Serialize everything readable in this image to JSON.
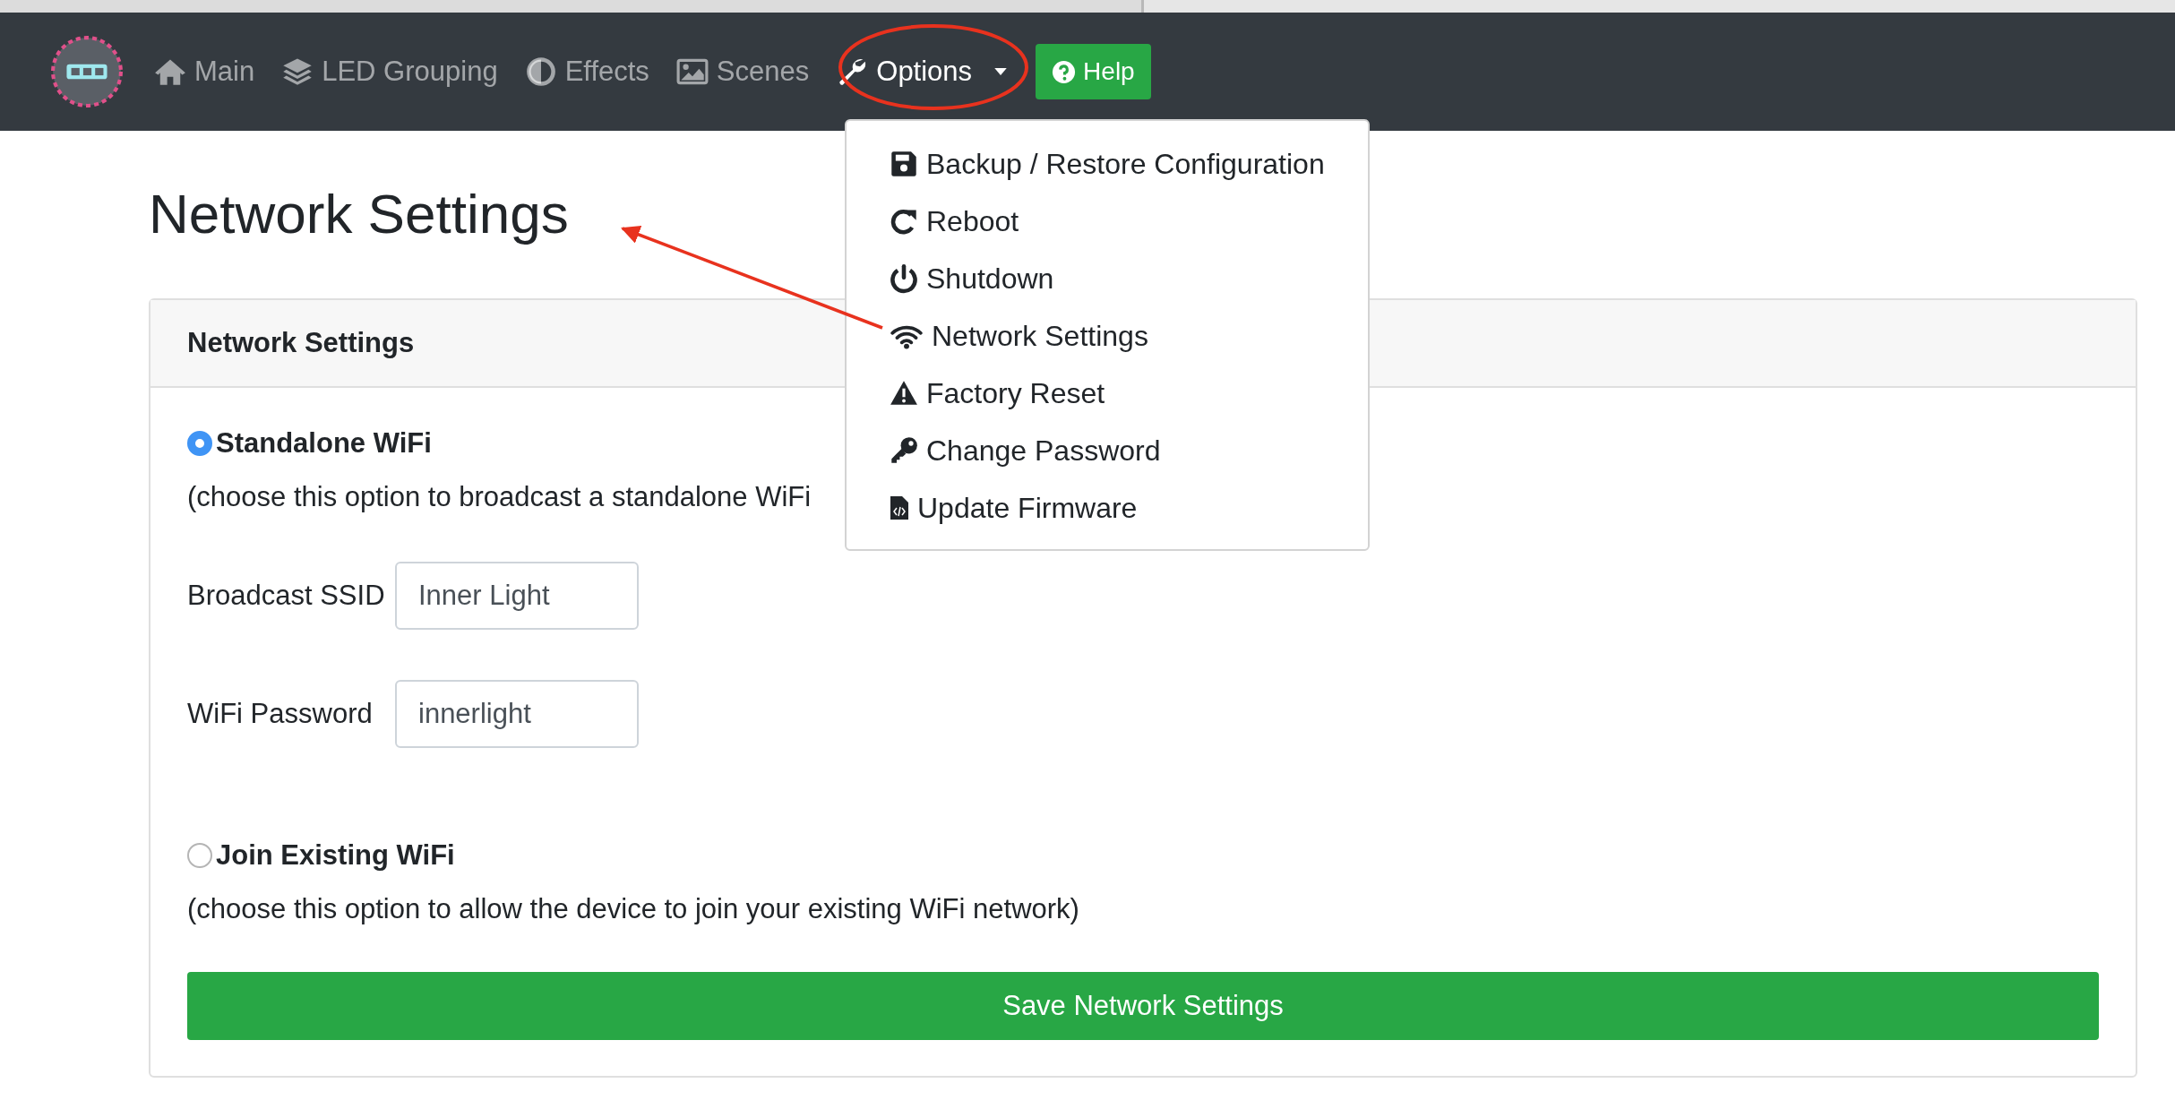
{
  "navbar": {
    "items": [
      {
        "label": "Main",
        "selected": false
      },
      {
        "label": "LED Grouping",
        "selected": false
      },
      {
        "label": "Effects",
        "selected": false
      },
      {
        "label": "Scenes",
        "selected": false
      },
      {
        "label": "Options",
        "selected": true,
        "expanded": true
      }
    ],
    "help_button": "Help"
  },
  "options_menu": [
    "Backup / Restore Configuration",
    "Reboot",
    "Shutdown",
    "Network Settings",
    "Factory Reset",
    "Change Password",
    "Update Firmware"
  ],
  "page_title": "Network Settings",
  "card": {
    "header": "Network Settings",
    "modes": [
      {
        "label": "Standalone WiFi",
        "selected": true,
        "description": "(choose this option to broadcast a standalone WiFi",
        "fields": [
          {
            "label": "Broadcast SSID",
            "value": "Inner Light"
          },
          {
            "label": "WiFi Password",
            "value": "innerlight"
          }
        ]
      },
      {
        "label": "Join Existing WiFi",
        "selected": false,
        "description": "(choose this option to allow the device to join your existing WiFi network)"
      }
    ],
    "save_button": "Save Network Settings"
  }
}
